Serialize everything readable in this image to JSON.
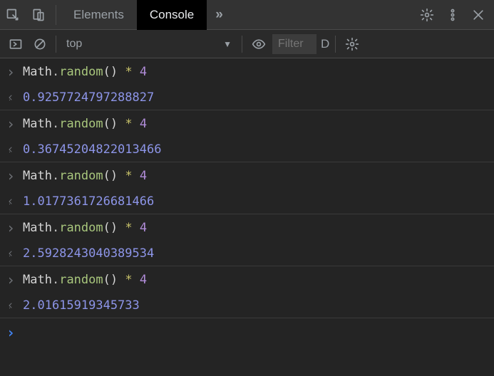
{
  "tabs": {
    "elements": "Elements",
    "console": "Console",
    "more": "»"
  },
  "toolbar": {
    "context": "top",
    "filter_placeholder": "Filter",
    "levels_truncated": "D"
  },
  "entries": [
    {
      "obj": "Math",
      "method": "random",
      "op": "*",
      "arg": "4",
      "result": "0.9257724797288827"
    },
    {
      "obj": "Math",
      "method": "random",
      "op": "*",
      "arg": "4",
      "result": "0.36745204822013466"
    },
    {
      "obj": "Math",
      "method": "random",
      "op": "*",
      "arg": "4",
      "result": "1.0177361726681466"
    },
    {
      "obj": "Math",
      "method": "random",
      "op": "*",
      "arg": "4",
      "result": "2.5928243040389534"
    },
    {
      "obj": "Math",
      "method": "random",
      "op": "*",
      "arg": "4",
      "result": "2.01615919345733"
    }
  ]
}
